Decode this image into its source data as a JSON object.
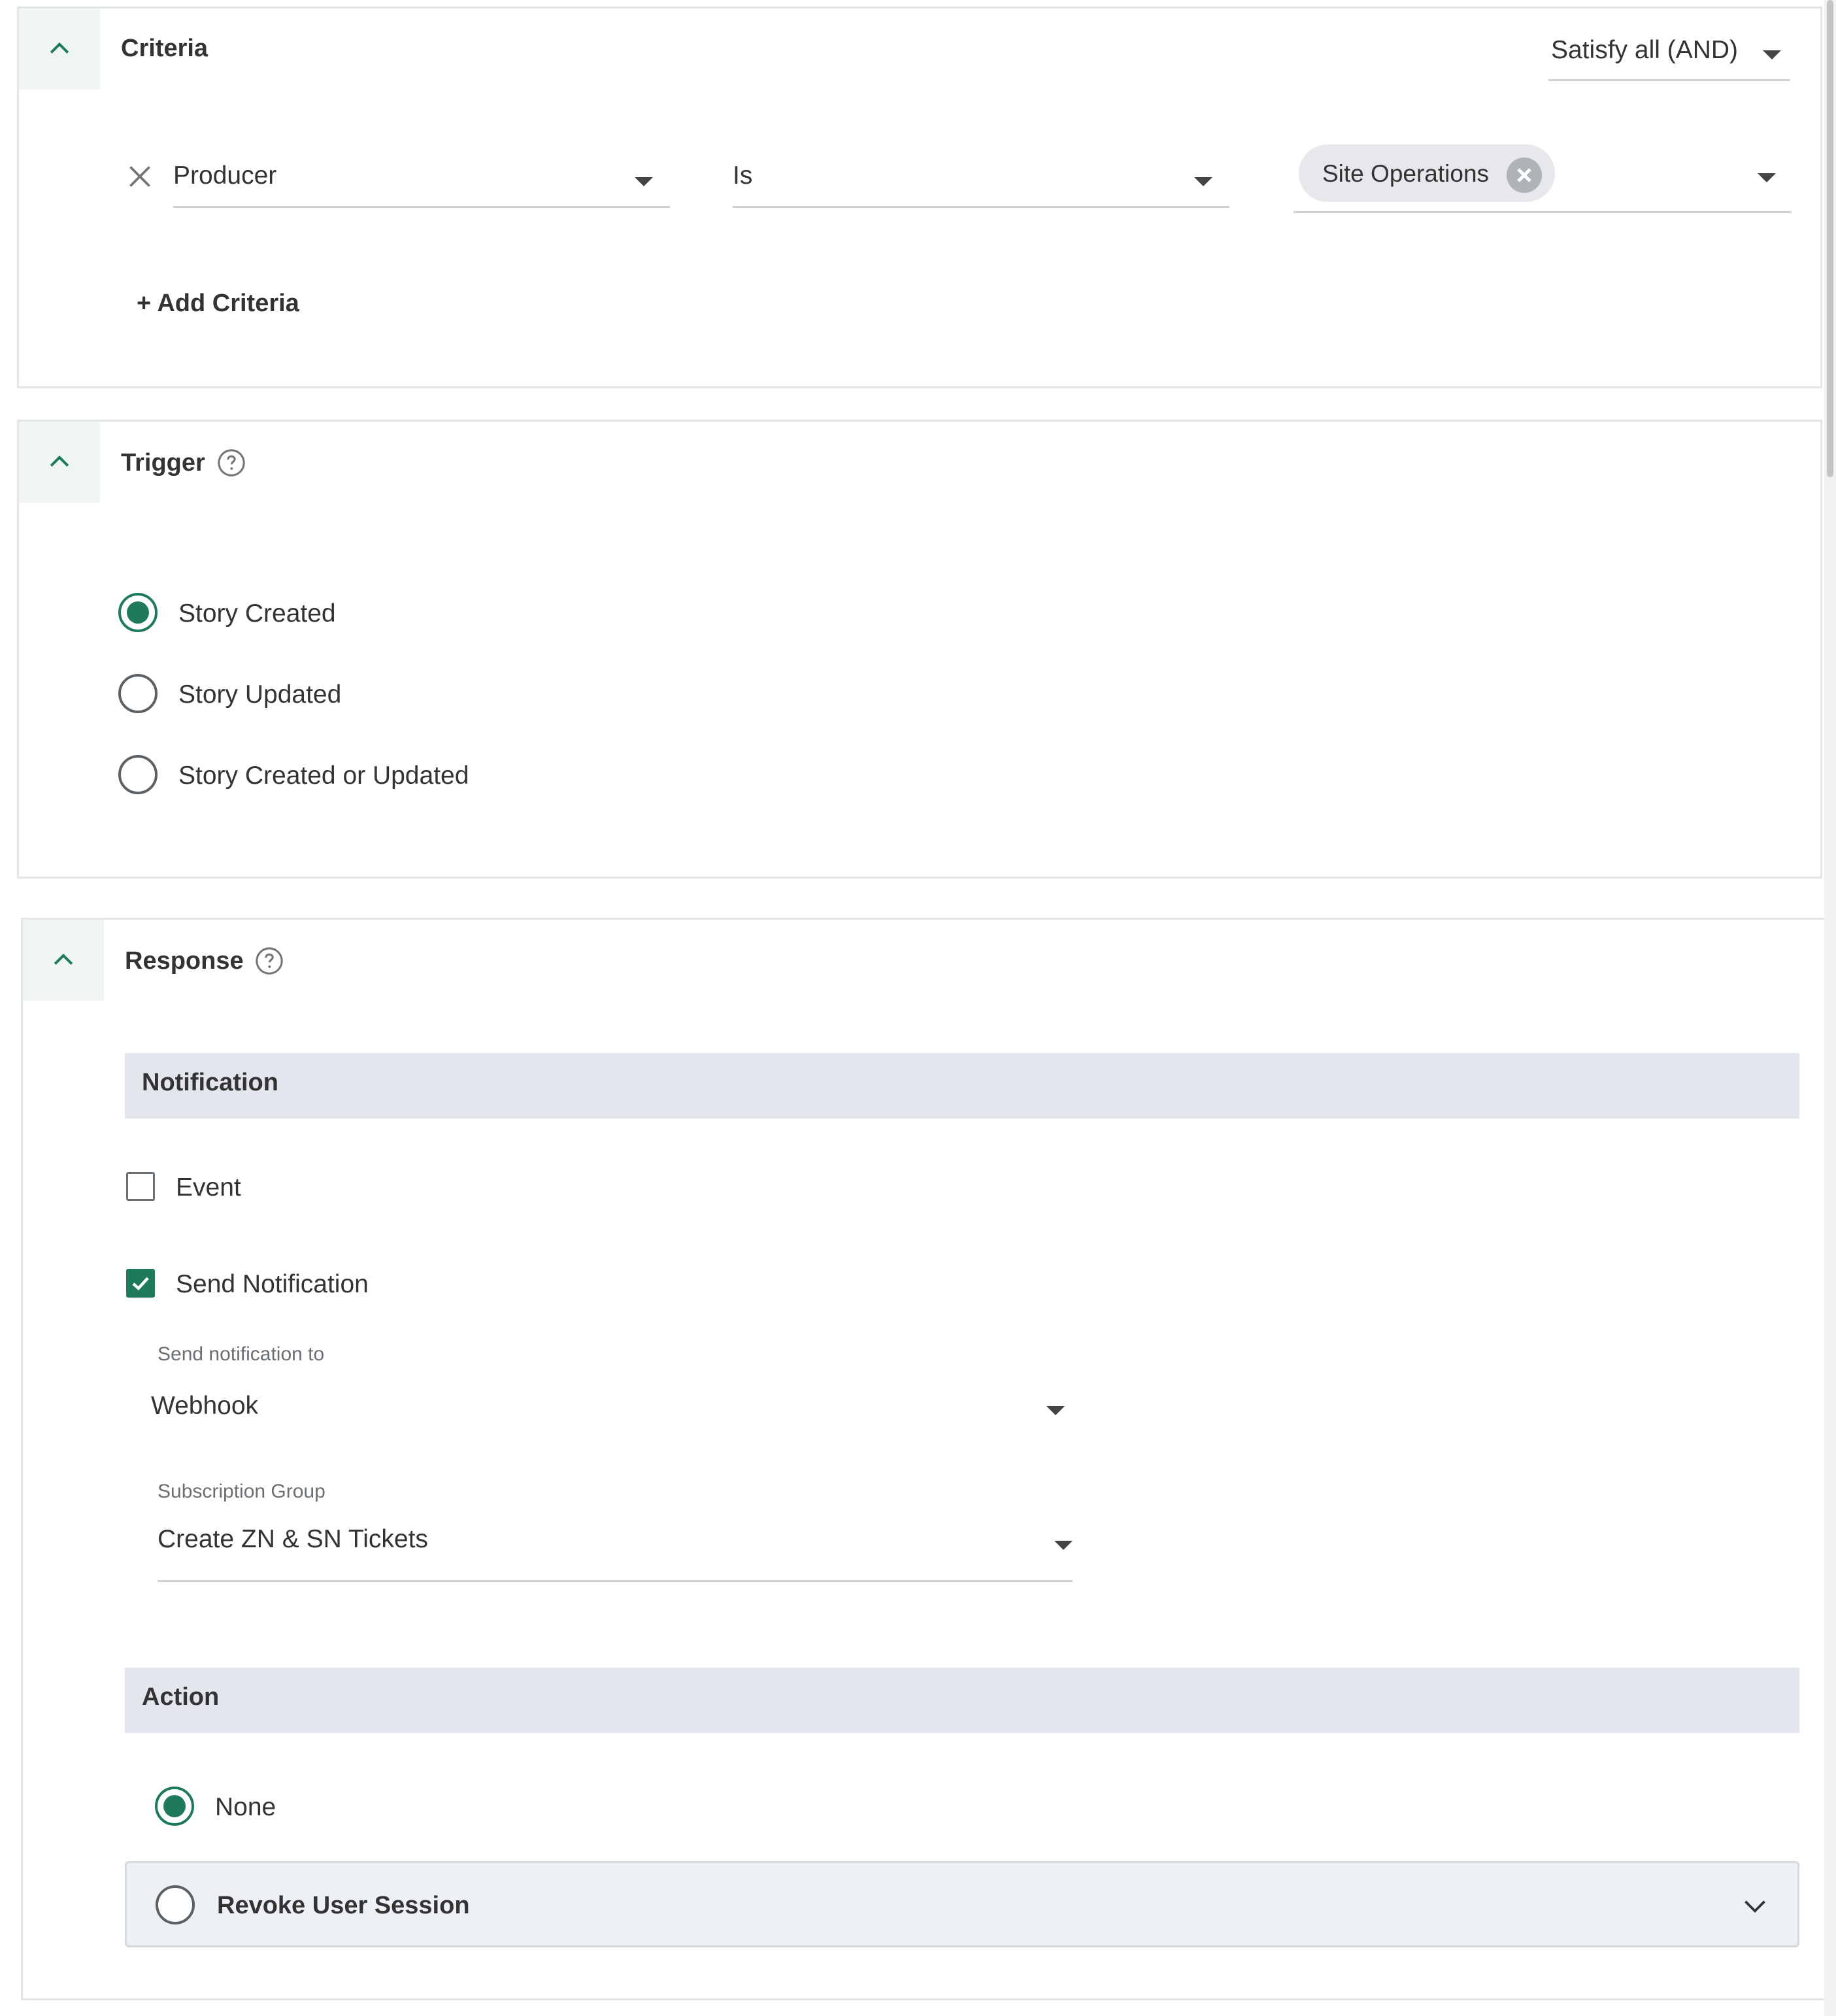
{
  "criteria": {
    "title": "Criteria",
    "match_mode": "Satisfy all (AND)",
    "row": {
      "field": "Producer",
      "operator": "Is",
      "value_chip": "Site Operations"
    },
    "add_label": "+ Add Criteria"
  },
  "trigger": {
    "title": "Trigger",
    "options": [
      {
        "label": "Story Created",
        "selected": true
      },
      {
        "label": "Story Updated",
        "selected": false
      },
      {
        "label": "Story Created or Updated",
        "selected": false
      }
    ]
  },
  "response": {
    "title": "Response",
    "notification": {
      "section_title": "Notification",
      "event_label": "Event",
      "event_checked": false,
      "send_label": "Send Notification",
      "send_checked": true,
      "send_to_label": "Send notification to",
      "send_to_value": "Webhook",
      "subscription_label": "Subscription Group",
      "subscription_value": "Create ZN & SN Tickets"
    },
    "action": {
      "section_title": "Action",
      "options": [
        {
          "label": "None",
          "selected": true
        },
        {
          "label": "Revoke User Session",
          "selected": false
        }
      ]
    }
  },
  "colors": {
    "accent": "#1e7a58",
    "section_bar": "#e3e7ed",
    "collapse_tab": "#eef5f2"
  },
  "icons": [
    "chevron-up-icon",
    "help-icon",
    "close-icon",
    "caret-down-icon",
    "chevron-down-icon",
    "check-icon"
  ]
}
